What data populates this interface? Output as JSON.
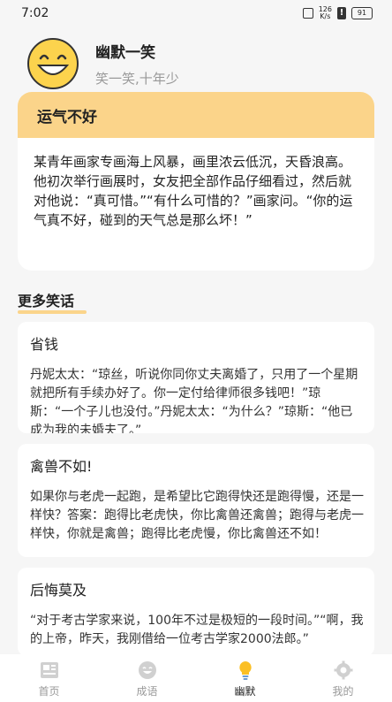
{
  "status_bar": {
    "time": "7:02",
    "speed_value": "126",
    "speed_unit": "K/s",
    "battery": "91"
  },
  "header": {
    "title": "幽默一笑",
    "subtitle": "笑一笑,十年少",
    "avatar_icon": "smiley-face-icon"
  },
  "featured": {
    "title": "运气不好",
    "body": "某青年画家专画海上风暴，画里浓云低沉，天昏浪高。他初次举行画展时，女友把全部作品仔细看过，然后就对他说：“真可惜。”“有什么可惜的？”画家问。“你的运气真不好，碰到的天气总是那么坏！”"
  },
  "section": {
    "title": "更多笑话"
  },
  "jokes": [
    {
      "title": "省钱",
      "body": "丹妮太太：“琼丝，听说你同你丈夫离婚了，只用了一个星期就把所有手续办好了。你一定付给律师很多钱吧！”琼斯：“一个子儿也没付。”丹妮太太：“为什么？”琼斯：“他已成为我的未婚夫了。”"
    },
    {
      "title": "禽兽不如!",
      "body": "如果你与老虎一起跑，是希望比它跑得快还是跑得慢，还是一样快？答案：跑得比老虎快，你比禽兽还禽兽；跑得与老虎一样快，你就是禽兽；跑得比老虎慢，你比禽兽还不如！"
    },
    {
      "title": "后悔莫及",
      "body": "“对于考古学家来说，100年不过是极短的一段时间。”“啊，我的上帝，昨天，我刚借给一位考古学家2000法郎。”"
    }
  ],
  "nav": {
    "items": [
      {
        "label": "首页",
        "icon": "newspaper-icon"
      },
      {
        "label": "成语",
        "icon": "smile-icon"
      },
      {
        "label": "幽默",
        "icon": "lightbulb-icon"
      },
      {
        "label": "我的",
        "icon": "gear-icon"
      }
    ],
    "active": "幽默"
  },
  "colors": {
    "accent": "#fbd48a",
    "background": "#f6f6f6",
    "card": "#ffffff"
  }
}
